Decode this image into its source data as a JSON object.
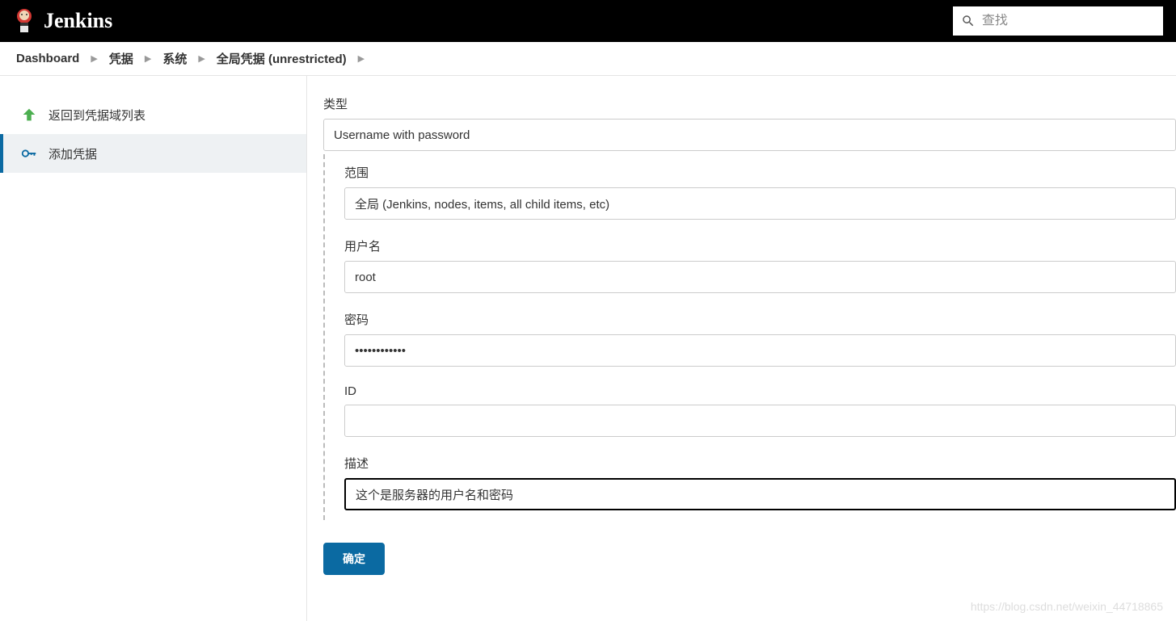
{
  "header": {
    "logo_text": "Jenkins",
    "search_placeholder": "查找"
  },
  "breadcrumbs": [
    "Dashboard",
    "凭据",
    "系统",
    "全局凭据 (unrestricted)"
  ],
  "sidebar": {
    "back_label": "返回到凭据域列表",
    "add_label": "添加凭据"
  },
  "form": {
    "type_label": "类型",
    "type_value": "Username with password",
    "scope_label": "范围",
    "scope_value": "全局 (Jenkins, nodes, items, all child items, etc)",
    "username_label": "用户名",
    "username_value": "root",
    "password_label": "密码",
    "password_value": "••••••••••••",
    "id_label": "ID",
    "id_value": "",
    "description_label": "描述",
    "description_value": "这个是服务器的用户名和密码",
    "submit_label": "确定"
  },
  "watermark": "https://blog.csdn.net/weixin_44718865"
}
